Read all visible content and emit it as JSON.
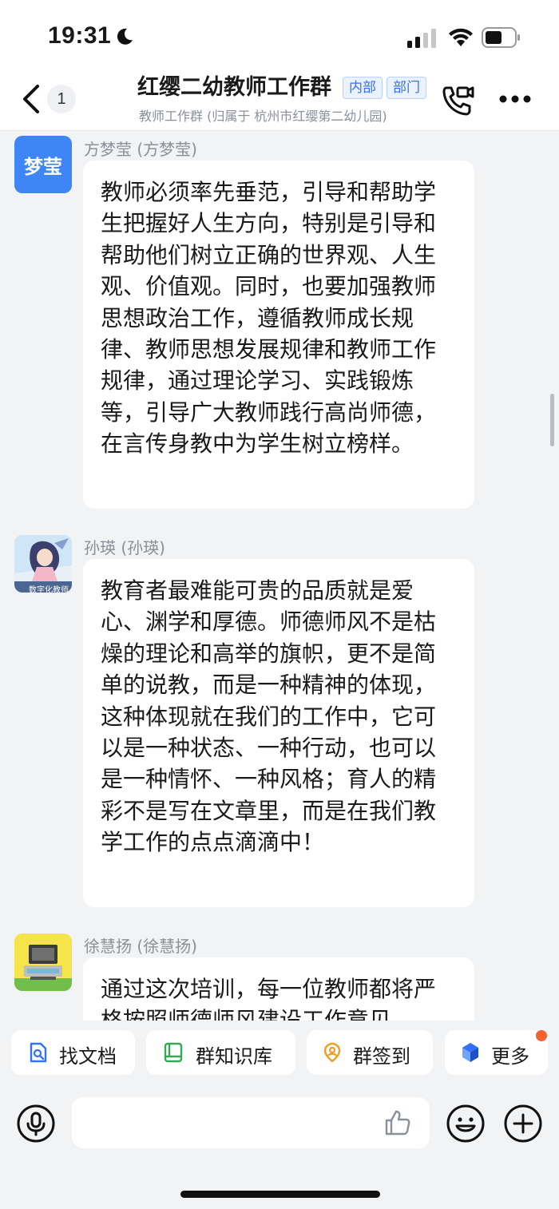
{
  "status_bar": {
    "time": "19:31",
    "icons": [
      "moon-icon",
      "signal-icon",
      "wifi-icon",
      "battery-icon"
    ]
  },
  "header": {
    "unread_count": "1",
    "title": "红缨二幼教师工作群",
    "tags": [
      "内部",
      "部门"
    ],
    "subtitle": "教师工作群 (归属于 杭州市红缨第二幼儿园)",
    "icons": [
      "back-icon",
      "video-call-icon",
      "more-icon"
    ]
  },
  "messages": [
    {
      "avatar_text": "梦莹",
      "avatar_color": "#3e86f5",
      "sender": "方梦莹 (方梦莹)",
      "text": "教师必须率先垂范，引导和帮助学生把握好人生方向，特别是引导和帮助他们树立正确的世界观、人生观、价值观。同时，也要加强教师思想政治工作，遵循教师成长规律、教师思想发展规律和教师工作规律，通过理论学习、实践锻炼等，引导广大教师践行高尚师德，在言传身教中为学生树立榜样。"
    },
    {
      "avatar_caption": "数字化教师",
      "sender": "孙瑛 (孙瑛)",
      "text": "教育者最难能可贵的品质就是爱心、渊学和厚德。师德师风不是枯燥的理论和高举的旗帜，更不是简单的说教，而是一种精神的体现，这种体现就在我们的工作中，它可以是一种状态、一种行动，也可以是一种情怀、一种风格；育人的精彩不是写在文章里，而是在我们教学工作的点点滴滴中！"
    },
    {
      "sender": "徐慧扬 (徐慧扬)",
      "text": "通过这次培训，每一位教师都将严格按照师德师风建设工作意见"
    }
  ],
  "quick_actions": [
    {
      "label": "找文档",
      "icon": "doc-search-icon"
    },
    {
      "label": "群知识库",
      "icon": "knowledge-base-icon"
    },
    {
      "label": "群签到",
      "icon": "check-in-icon"
    },
    {
      "label": "更多",
      "icon": "more-apps-icon"
    }
  ],
  "input": {
    "placeholder": "",
    "icons": [
      "mic-icon",
      "thumbs-up-icon",
      "emoji-icon",
      "plus-icon"
    ]
  },
  "colors": {
    "accent": "#3370ff",
    "background": "#f2f3f5",
    "notification_dot": "#f5622d"
  }
}
